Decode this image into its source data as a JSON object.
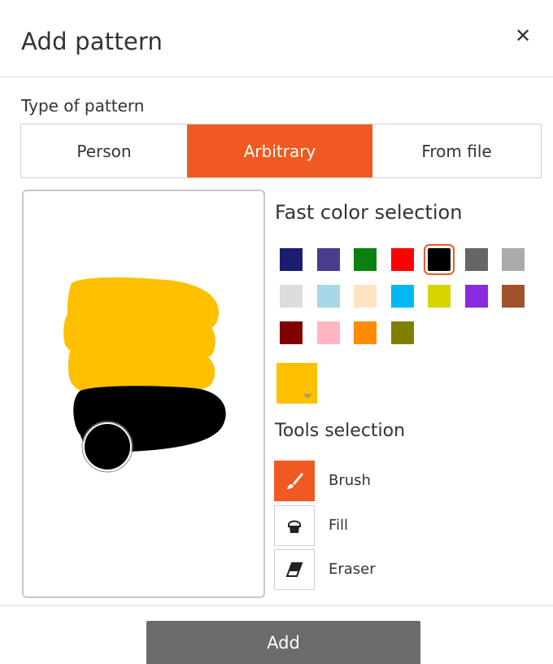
{
  "dialog": {
    "title": "Add pattern",
    "close_icon": "close-icon"
  },
  "type_of_pattern": {
    "label": "Type of pattern",
    "options": [
      "Person",
      "Arbitrary",
      "From file"
    ],
    "selected": "Arbitrary"
  },
  "fast_color": {
    "label": "Fast color selection",
    "colors": [
      "#1b1d6e",
      "#4a3d8f",
      "#0d7f10",
      "#ff0000",
      "#000000",
      "#666666",
      "#aaaaaa",
      "#dddddd",
      "#a8d8e8",
      "#ffe4c4",
      "#00b8f0",
      "#d6d400",
      "#8a2be2",
      "#a0522d",
      "#800000",
      "#ffb6c1",
      "#ff8c00",
      "#808000"
    ],
    "selected": "#000000",
    "current": "#ffc000"
  },
  "tools": {
    "label": "Tools selection",
    "items": [
      {
        "name": "Brush",
        "icon": "brush-icon"
      },
      {
        "name": "Fill",
        "icon": "fill-bucket-icon"
      },
      {
        "name": "Eraser",
        "icon": "eraser-icon"
      }
    ],
    "selected": "Brush"
  },
  "colors": {
    "accent": "#f05a22",
    "add_button": "#6b6b6b"
  },
  "footer": {
    "add_label": "Add"
  }
}
